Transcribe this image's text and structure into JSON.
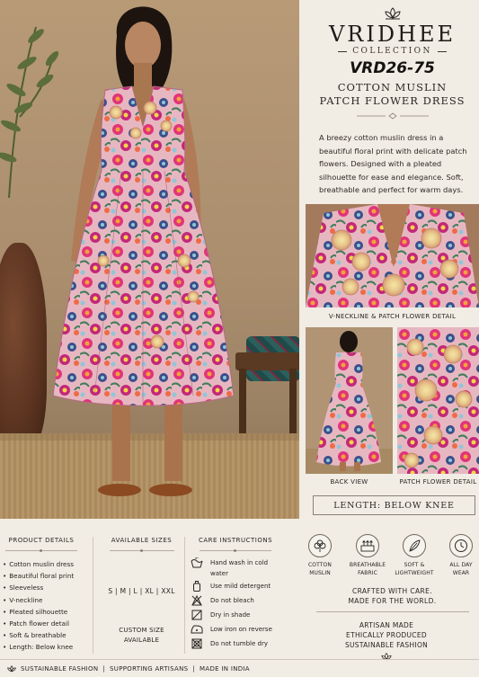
{
  "brand": {
    "name": "VRIDHEE",
    "sub": "COLLECTION",
    "sku": "VRD26-75",
    "title_line1": "COTTON MUSLIN",
    "title_line2": "PATCH FLOWER DRESS"
  },
  "description": "A breezy cotton muslin dress in a beautiful floral print with delicate patch flowers. Designed with a pleated silhouette for ease and elegance. Soft, breathable and perfect for warm days.",
  "gallery": {
    "neckline_caption": "V-NECKLINE & PATCH FLOWER DETAIL",
    "back_caption": "BACK VIEW",
    "patch_caption": "PATCH FLOWER DETAIL"
  },
  "length_label": "LENGTH: BELOW KNEE",
  "product_details": {
    "title": "PRODUCT DETAILS",
    "items": [
      "Cotton muslin dress",
      "Beautiful floral print",
      "Sleeveless",
      "V-neckline",
      "Pleated silhouette",
      "Patch flower detail",
      "Soft & breathable",
      "Length: Below knee"
    ]
  },
  "sizes": {
    "title": "AVAILABLE SIZES",
    "list": "S | M | L | XL | XXL",
    "custom_line1": "CUSTOM SIZE",
    "custom_line2": "AVAILABLE"
  },
  "care": {
    "title": "CARE INSTRUCTIONS",
    "items": [
      {
        "icon": "hand-wash-icon",
        "text": "Hand wash in cold water"
      },
      {
        "icon": "mild-detergent-icon",
        "text": "Use mild detergent"
      },
      {
        "icon": "no-bleach-icon",
        "text": "Do not bleach"
      },
      {
        "icon": "dry-in-shade-icon",
        "text": "Dry in shade"
      },
      {
        "icon": "low-iron-icon",
        "text": "Low iron on reverse"
      },
      {
        "icon": "no-tumble-dry-icon",
        "text": "Do not tumble dry"
      }
    ]
  },
  "features": [
    {
      "icon": "cotton-icon",
      "line1": "COTTON",
      "line2": "MUSLIN"
    },
    {
      "icon": "breathable-icon",
      "line1": "BREATHABLE",
      "line2": "FABRIC"
    },
    {
      "icon": "feather-icon",
      "line1": "SOFT &",
      "line2": "LIGHTWEIGHT"
    },
    {
      "icon": "clock-icon",
      "line1": "ALL DAY",
      "line2": "WEAR"
    }
  ],
  "crafted": {
    "line1": "CRAFTED WITH CARE.",
    "line2": "MADE FOR THE WORLD."
  },
  "artisan": {
    "line1": "ARTISAN MADE",
    "line2": "ETHICALLY PRODUCED",
    "line3": "SUSTAINABLE FASHION"
  },
  "footer": {
    "a": "SUSTAINABLE FASHION",
    "b": "SUPPORTING ARTISANS",
    "c": "MADE IN INDIA",
    "sep": "|"
  },
  "colors": {
    "background": "#f1ece4",
    "text": "#2a2622",
    "print_pink": "#e0347a",
    "print_blue": "#3b4f8a"
  }
}
